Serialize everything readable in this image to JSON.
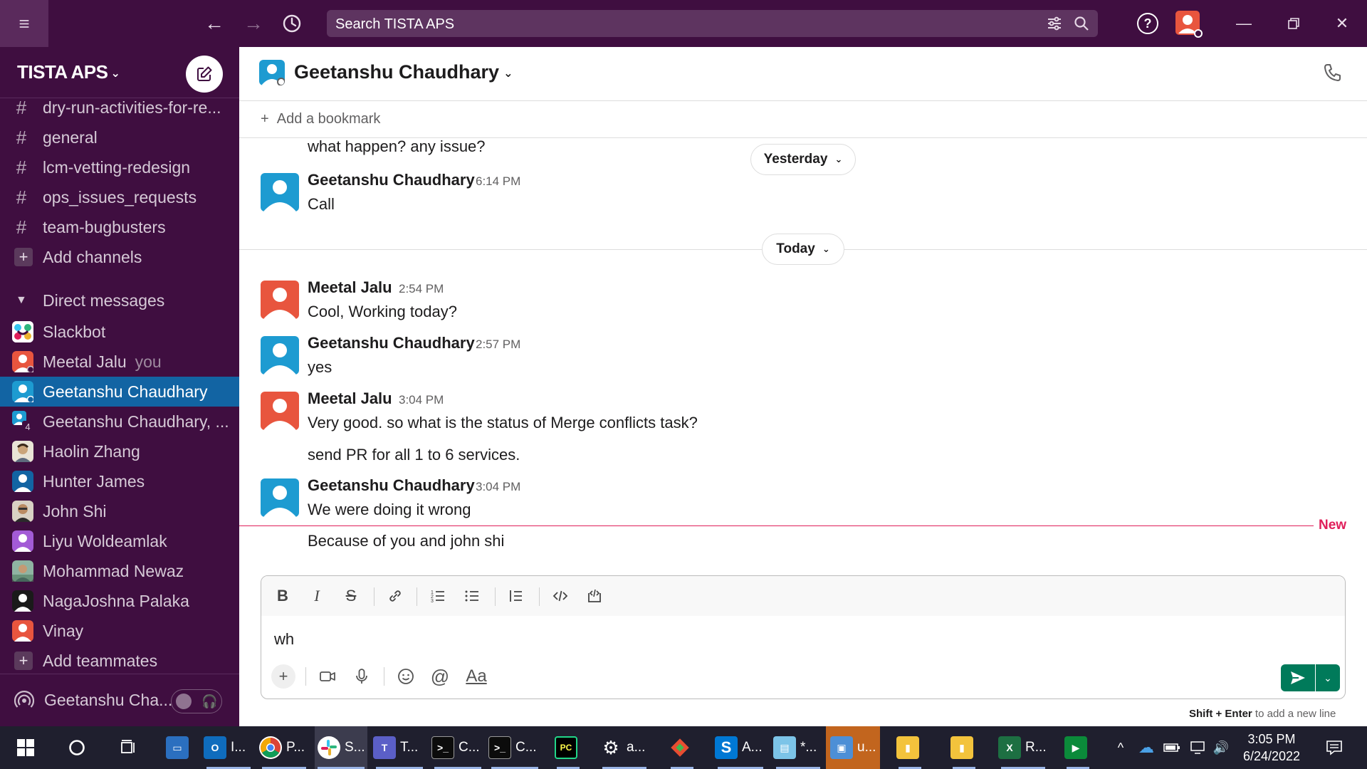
{
  "search": {
    "placeholder": "Search TISTA APS"
  },
  "workspace": {
    "name": "TISTA APS"
  },
  "channels": [
    {
      "name": "dry-run-activities-for-re..."
    },
    {
      "name": "general"
    },
    {
      "name": "lcm-vetting-redesign"
    },
    {
      "name": "ops_issues_requests"
    },
    {
      "name": "team-bugbusters"
    }
  ],
  "add_channels": "Add channels",
  "dm_section": "Direct messages",
  "direct_messages": [
    {
      "name": "Slackbot",
      "suffix": ""
    },
    {
      "name": "Meetal Jalu",
      "suffix": "you"
    },
    {
      "name": "Geetanshu Chaudhary",
      "suffix": ""
    },
    {
      "name": "Geetanshu Chaudhary, ...",
      "suffix": ""
    },
    {
      "name": "Haolin Zhang",
      "suffix": ""
    },
    {
      "name": "Hunter James",
      "suffix": ""
    },
    {
      "name": "John Shi",
      "suffix": ""
    },
    {
      "name": "Liyu Woldeamlak",
      "suffix": ""
    },
    {
      "name": "Mohammad Newaz",
      "suffix": ""
    },
    {
      "name": "NagaJoshna Palaka",
      "suffix": ""
    },
    {
      "name": "Vinay",
      "suffix": ""
    }
  ],
  "group_dm_count": "4",
  "add_teammates": "Add teammates",
  "huddle_user": "Geetanshu Cha...",
  "conversation": {
    "title": "Geetanshu Chaudhary"
  },
  "bookmark": {
    "label": "Add a bookmark"
  },
  "dividers": {
    "yesterday": "Yesterday",
    "today": "Today",
    "new": "New"
  },
  "messages": {
    "partial_text": "what happen? any issue?",
    "m1": {
      "author": "Geetanshu Chaudhary",
      "time": "6:14 PM",
      "text": "Call"
    },
    "m2": {
      "author": "Meetal Jalu",
      "time": "2:54 PM",
      "text": "Cool, Working today?"
    },
    "m3": {
      "author": "Geetanshu Chaudhary",
      "time": "2:57 PM",
      "text": "yes"
    },
    "m4": {
      "author": "Meetal Jalu",
      "time": "3:04 PM",
      "text": "Very good. so what is the status of Merge conflicts task?",
      "text2": "send PR for all 1 to 6 services."
    },
    "m5": {
      "author": "Geetanshu Chaudhary",
      "time": "3:04 PM",
      "text": "We were doing it wrong",
      "text2": "Because of you and john shi"
    }
  },
  "composer": {
    "value": "wh",
    "hint_keys": "Shift + Enter",
    "hint_text": " to add a new line",
    "format_label": "Aa"
  },
  "taskbar": {
    "apps": [
      {
        "label": "I...",
        "icon": "outlook-icon"
      },
      {
        "label": "P...",
        "icon": "chrome-icon"
      },
      {
        "label": "S...",
        "icon": "slack-icon"
      },
      {
        "label": "T...",
        "icon": "teams-icon"
      },
      {
        "label": "C...",
        "icon": "terminal-icon"
      },
      {
        "label": "C...",
        "icon": "terminal-icon"
      },
      {
        "label": "",
        "icon": "pycharm-icon"
      },
      {
        "label": "a...",
        "icon": "settings-app-icon"
      },
      {
        "label": "",
        "icon": "git-icon"
      },
      {
        "label": "A...",
        "icon": "azure-icon"
      },
      {
        "label": "*...",
        "icon": "notepad-icon"
      },
      {
        "label": "u...",
        "icon": "remote-desktop-icon"
      },
      {
        "label": "R...",
        "icon": "excel-icon"
      }
    ],
    "time": "3:05 PM",
    "date": "6/24/2022"
  },
  "colors": {
    "sidebar_bg": "#3f0e40",
    "active_item": "#1264a3",
    "send_button": "#007a5a",
    "new_divider": "#e01e5a"
  }
}
